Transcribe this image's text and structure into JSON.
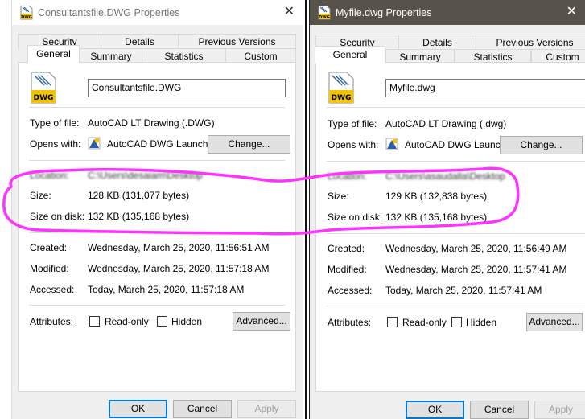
{
  "dialogs": [
    {
      "title": "Consultantsfile.DWG Properties",
      "close_glyph": "✕",
      "tabs_row1": [
        "Security",
        "Details",
        "Previous Versions"
      ],
      "tabs_row2": [
        "General",
        "Summary",
        "Statistics",
        "Custom"
      ],
      "active_tab": "General",
      "file_icon_badge": "DWG",
      "filename": "Consultantsfile.DWG",
      "type_label": "Type of file:",
      "type_value": "AutoCAD LT Drawing (.DWG)",
      "opens_label": "Opens with:",
      "opens_value": "AutoCAD DWG Launcher",
      "change_button": "Change...",
      "location_label": "Location:",
      "location_value": "C:\\Users\\desaiam\\Desktop",
      "size_label": "Size:",
      "size_value": "128 KB (131,077 bytes)",
      "size_on_disk_label": "Size on disk:",
      "size_on_disk_value": "132 KB (135,168 bytes)",
      "created_label": "Created:",
      "created_value": "Wednesday, March 25, 2020, 11:56:51 AM",
      "modified_label": "Modified:",
      "modified_value": "Wednesday, March 25, 2020, 11:57:18 AM",
      "accessed_label": "Accessed:",
      "accessed_value": "Today, March 25, 2020, 11:57:18 AM",
      "attributes_label": "Attributes:",
      "readonly_label": "Read-only",
      "hidden_label": "Hidden",
      "advanced_button": "Advanced...",
      "ok_button": "OK",
      "cancel_button": "Cancel",
      "apply_button": "Apply"
    },
    {
      "title": "Myfile.dwg Properties",
      "close_glyph": "✕",
      "tabs_row1": [
        "Security",
        "Details",
        "Previous Versions"
      ],
      "tabs_row2": [
        "General",
        "Summary",
        "Statistics",
        "Custom"
      ],
      "active_tab": "General",
      "file_icon_badge": "DWG",
      "filename": "Myfile.dwg",
      "type_label": "Type of file:",
      "type_value": "AutoCAD LT Drawing (.dwg)",
      "opens_label": "Opens with:",
      "opens_value": "AutoCAD DWG Launcher",
      "change_button": "Change...",
      "location_label": "Location:",
      "location_value": "C:\\Users\\asaudalla\\Desktop",
      "size_label": "Size:",
      "size_value": "129 KB (132,838 bytes)",
      "size_on_disk_label": "Size on disk:",
      "size_on_disk_value": "132 KB (135,168 bytes)",
      "created_label": "Created:",
      "created_value": "Wednesday, March 25, 2020, 11:56:49 AM",
      "modified_label": "Modified:",
      "modified_value": "Wednesday, March 25, 2020, 11:57:41 AM",
      "accessed_label": "Accessed:",
      "accessed_value": "Today, March 25, 2020, 11:57:41 AM",
      "attributes_label": "Attributes:",
      "readonly_label": "Read-only",
      "hidden_label": "Hidden",
      "advanced_button": "Advanced...",
      "ok_button": "OK",
      "cancel_button": "Cancel",
      "apply_button": "Apply"
    }
  ],
  "annotation": {
    "shape": "freehand-loop",
    "color": "#ff33ff",
    "highlights": [
      "Size",
      "Size on disk"
    ]
  },
  "colors": {
    "dialog_bg": "#f0f0f0",
    "panel_bg": "#ffffff",
    "active_titlebar": "#57534b",
    "default_button_border": "#0078d7",
    "dwg_icon_yellow": "#f2c500",
    "dwg_icon_blue": "#2b5fa8"
  }
}
